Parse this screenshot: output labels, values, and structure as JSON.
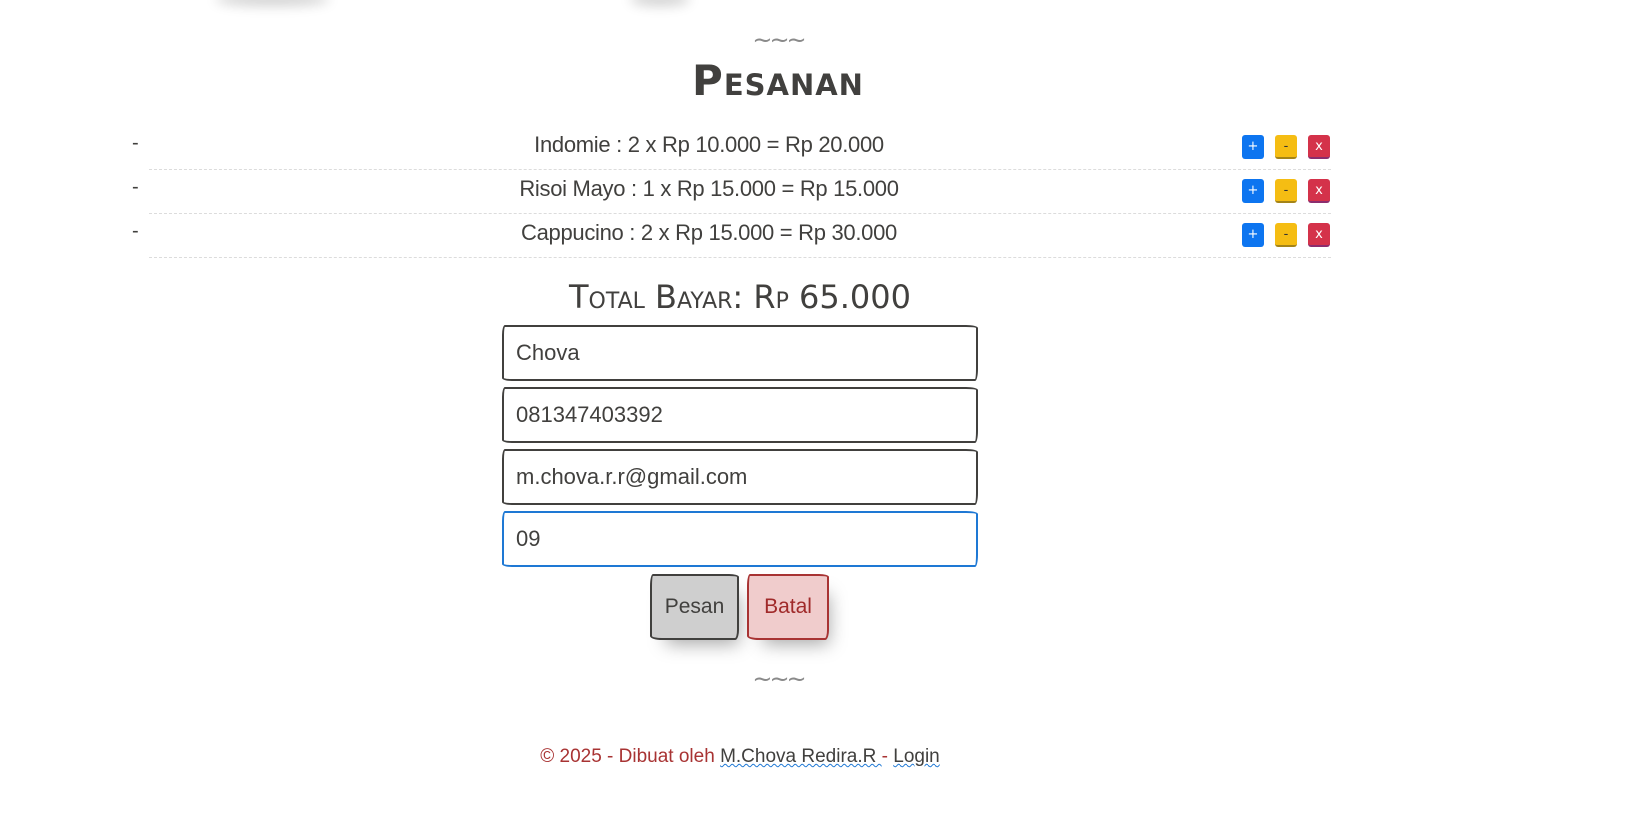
{
  "section": {
    "divider_top": "~~~",
    "title": "Pesanan",
    "divider_bottom": "~~~"
  },
  "orders": [
    {
      "bullet": "-",
      "text": "Indomie : 2 x Rp 10.000 = Rp 20.000",
      "plus": "+",
      "minus": "-",
      "remove": "x"
    },
    {
      "bullet": "-",
      "text": "Risoi Mayo : 1 x Rp 15.000 = Rp 15.000",
      "plus": "+",
      "minus": "-",
      "remove": "x"
    },
    {
      "bullet": "-",
      "text": "Cappucino : 2 x Rp 15.000 = Rp 30.000",
      "plus": "+",
      "minus": "-",
      "remove": "x"
    }
  ],
  "total": "Total Bayar: Rp 65.000",
  "form": {
    "name_value": "Chova",
    "phone_value": "081347403392",
    "email_value": "m.chova.r.r@gmail.com",
    "fourth_value": "09"
  },
  "buttons": {
    "submit_label": "Pesan",
    "cancel_label": "Batal"
  },
  "footer": {
    "prefix": "© 2025 - Dibuat oleh ",
    "author_link": "M.Chova Redira.R ",
    "separator": " - ",
    "login_link": "Login"
  },
  "colors": {
    "plus_button": "#0d75f0",
    "minus_button": "#f5bd13",
    "remove_button": "#d4324a",
    "cancel_bg": "#f0cccc",
    "focus_border": "#1e78d4"
  }
}
